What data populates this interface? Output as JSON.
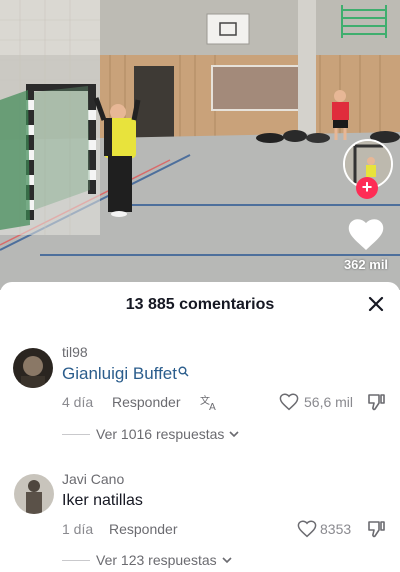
{
  "video": {
    "like_count": "362 mil"
  },
  "comments_panel": {
    "title": "13 885 comentarios",
    "comments": [
      {
        "username": "til98",
        "text": "Gianluigi Buffet",
        "search_icon": "search-icon",
        "time": "4 día",
        "reply_label": "Responder",
        "translate_icon": "translate-icon",
        "likes": "56,6 mil",
        "replies_label": "Ver 1016 respuestas"
      },
      {
        "username": "Javi Cano",
        "text": "Iker natillas",
        "time": "1 día",
        "reply_label": "Responder",
        "likes": "8353",
        "replies_label": "Ver 123 respuestas"
      }
    ]
  },
  "colors": {
    "follow_button": "#fe2c55",
    "highlight_text": "#2b5d8c"
  }
}
